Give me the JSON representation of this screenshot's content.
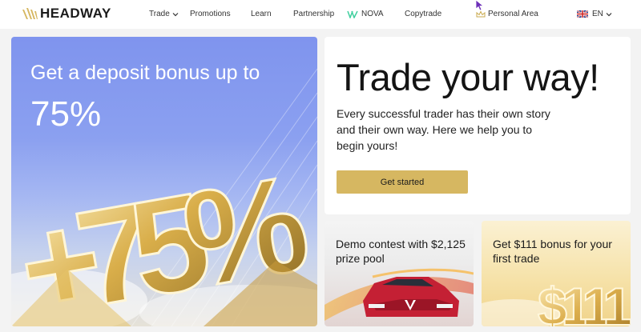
{
  "nav": {
    "brand": "HEADWAY",
    "items": [
      {
        "label": "Trade",
        "has_dropdown": true
      },
      {
        "label": "Promotions"
      },
      {
        "label": "Learn"
      },
      {
        "label": "Partnership"
      },
      {
        "label": "NOVA"
      },
      {
        "label": "Copytrade"
      },
      {
        "label": "Personal Area"
      }
    ],
    "language": "EN"
  },
  "promo": {
    "title": "Get a deposit bonus up to",
    "percent": "75%",
    "art_text": "+75%"
  },
  "hero": {
    "title": "Trade your way!",
    "subtitle": "Every successful trader has their own story and their own way. Here we help you to begin yours!",
    "button": "Get started"
  },
  "cards": {
    "demo": {
      "title": "Demo contest with $2,125 prize pool"
    },
    "bonus": {
      "title": "Get $111 bonus for your first trade",
      "art_text": "$111"
    }
  },
  "colors": {
    "accent_gold": "#d6b761",
    "nova_green": "#3fcf9e",
    "promo_blue": "#7f94ee"
  }
}
